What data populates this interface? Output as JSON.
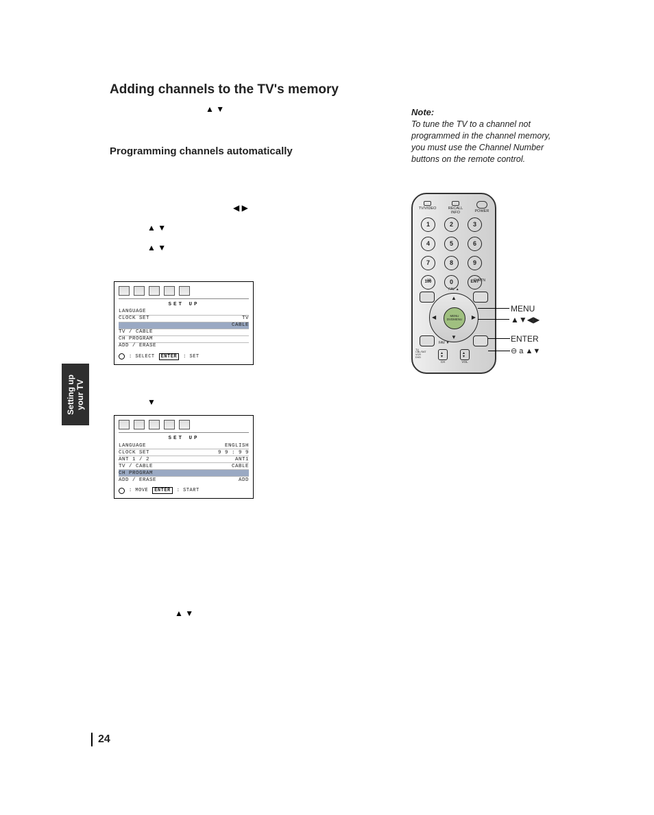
{
  "page_number": "24",
  "side_tab": {
    "line1": "Setting up",
    "line2": "your TV"
  },
  "title": "Adding channels to the TV's memory",
  "intro_arrows": "▲   ▼",
  "subhead": "Programming channels automatically",
  "body_arrows": {
    "lr": "◀   ▶",
    "ud1": "▲   ▼",
    "ud2": "▲   ▼",
    "d": "▼",
    "ud3": "▲   ▼"
  },
  "osd1": {
    "header": "SET  UP",
    "rows": [
      {
        "l": "LANGUAGE",
        "r": "",
        "sel": false
      },
      {
        "l": "CLOCK  SET",
        "r": "TV",
        "sel": false
      },
      {
        "l": "",
        "r": "CABLE",
        "sel": true
      },
      {
        "l": "TV / CABLE",
        "r": "",
        "sel": false
      },
      {
        "l": "CH  PROGRAM",
        "r": "",
        "sel": false
      },
      {
        "l": "ADD / ERASE",
        "r": "",
        "sel": false
      }
    ],
    "foot_dotlabel": ": SELECT",
    "foot_btn": "ENTER",
    "foot_btnlabel": ": SET"
  },
  "osd2": {
    "header": "SET  UP",
    "rows": [
      {
        "l": "LANGUAGE",
        "r": "ENGLISH",
        "sel": false
      },
      {
        "l": "CLOCK  SET",
        "r": "9 9 : 9 9",
        "sel": false
      },
      {
        "l": "ANT  1 / 2",
        "r": "ANT1",
        "sel": false
      },
      {
        "l": "TV / CABLE",
        "r": "CABLE",
        "sel": false
      },
      {
        "l": "CH  PROGRAM",
        "r": "",
        "sel": true
      },
      {
        "l": "ADD / ERASE",
        "r": "ADD",
        "sel": false
      }
    ],
    "foot_dotlabel": ": MOVE",
    "foot_btn": "ENTER",
    "foot_btnlabel": ": START"
  },
  "note": {
    "head": "Note:",
    "body": "To tune the TV to a channel not programmed in the channel memory, you must use the Channel Number buttons on the remote control."
  },
  "remote": {
    "top": {
      "tvvideo": "TV/VIDEO",
      "recall": "RECALL",
      "info": "INFO",
      "power": "POWER"
    },
    "numbers": [
      "1",
      "2",
      "3",
      "4",
      "5",
      "6",
      "7",
      "8",
      "9",
      "100",
      "0",
      "ENT"
    ],
    "plus10": "+10",
    "chrtn": "CHRTN",
    "fav_up": "FAV ▲",
    "fav_dn": "FAV ▼",
    "menu_top": "MENU",
    "menu_bot": "DVDMENU",
    "corners": {
      "tl": "",
      "tr": "",
      "bl": "",
      "br": ""
    },
    "bottom": {
      "ch": "CH",
      "vol": "VOL"
    },
    "side_labels": "TV\nCBL/SAT\nVCR\nDVD"
  },
  "callouts": {
    "menu": "MENU",
    "arrows": "▲▼◀▶",
    "enter": "ENTER",
    "icons": "⊖  a       ▲▼"
  }
}
